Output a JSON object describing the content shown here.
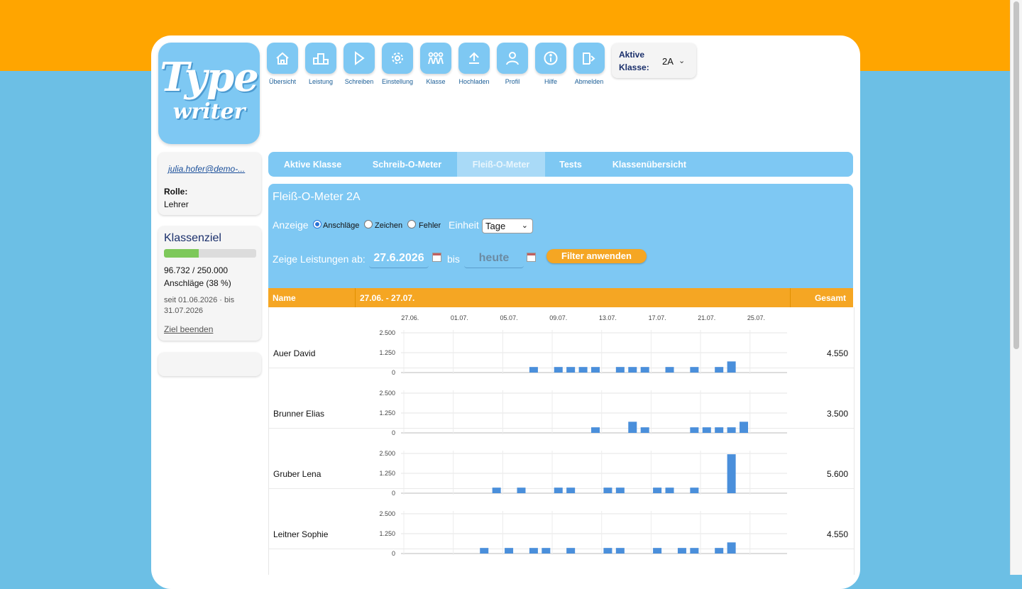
{
  "nav": [
    {
      "label": "Übersicht",
      "icon": "house-icon"
    },
    {
      "label": "Leistung",
      "icon": "podium-icon"
    },
    {
      "label": "Schreiben",
      "icon": "play-icon"
    },
    {
      "label": "Einstellung",
      "icon": "gear-icon"
    },
    {
      "label": "Klasse",
      "icon": "people-icon"
    },
    {
      "label": "Hochladen",
      "icon": "upload-icon"
    },
    {
      "label": "Profil",
      "icon": "user-icon"
    },
    {
      "label": "Hilfe",
      "icon": "info-icon"
    },
    {
      "label": "Abmelden",
      "icon": "logout-icon"
    }
  ],
  "logo": {
    "line1": "Type",
    "line2": "writer"
  },
  "class_select": {
    "label": "Aktive Klasse:",
    "value": "2A"
  },
  "user": {
    "email": "julia.hofer@demo-...",
    "role_label": "Rolle:",
    "role": "Lehrer"
  },
  "goal": {
    "title": "Klassenziel",
    "progress": 0.38,
    "numbers": "96.732 / 250.000",
    "unit": "Anschläge  (38 %)",
    "period": "seit 01.06.2026  · bis 31.07.2026",
    "end_link": "Ziel beenden"
  },
  "tabs": [
    "Aktive Klasse",
    "Schreib-O-Meter",
    "Fleiß-O-Meter",
    "Tests",
    "Klassenübersicht"
  ],
  "active_tab": 2,
  "panel": {
    "title": "Fleiß-O-Meter 2A",
    "anzeige_label": "Anzeige",
    "options": [
      "Anschläge",
      "Zeichen",
      "Fehler"
    ],
    "selected_option": 0,
    "einheit_label": "Einheit",
    "einheit_value": "Tage",
    "range_label": "Zeige Leistungen ab:",
    "from_value": "27.6.2026",
    "bis_label": "bis",
    "to_value": "heute",
    "filter_button": "Filter anwenden"
  },
  "table": {
    "col_name": "Name",
    "col_range": "27.06. - 27.07.",
    "col_total": "Gesamt"
  },
  "colors": {
    "bar": "#4a8fdb",
    "header": "#f5a623",
    "panel": "#7ec8f3",
    "band": "#ffa500",
    "background": "#6cbfe5"
  },
  "chart_data": {
    "type": "bar",
    "x_tick_labels": [
      "27.06.",
      "01.07.",
      "05.07.",
      "09.07.",
      "13.07.",
      "17.07.",
      "21.07.",
      "25.07."
    ],
    "y_tick_labels": [
      "2.500",
      "1.250",
      "0"
    ],
    "ylim": [
      0,
      2500
    ],
    "days": 31,
    "series": [
      {
        "name": "Auer David",
        "total": "4.550",
        "values": [
          0,
          0,
          0,
          0,
          0,
          0,
          0,
          0,
          0,
          0,
          350,
          0,
          350,
          350,
          350,
          350,
          0,
          350,
          350,
          350,
          0,
          350,
          0,
          350,
          0,
          350,
          700,
          0,
          0,
          0,
          0
        ]
      },
      {
        "name": "Brunner Elias",
        "total": "3.500",
        "values": [
          0,
          0,
          0,
          0,
          0,
          0,
          0,
          0,
          0,
          0,
          0,
          0,
          0,
          0,
          0,
          350,
          0,
          0,
          700,
          350,
          0,
          0,
          0,
          350,
          350,
          350,
          350,
          700,
          0,
          0,
          0
        ]
      },
      {
        "name": "Gruber Lena",
        "total": "5.600",
        "values": [
          0,
          0,
          0,
          0,
          0,
          0,
          0,
          350,
          0,
          350,
          0,
          0,
          350,
          350,
          0,
          0,
          350,
          350,
          0,
          0,
          350,
          350,
          0,
          350,
          0,
          0,
          2450,
          0,
          0,
          0,
          0
        ]
      },
      {
        "name": "Leitner Sophie",
        "total": "4.550",
        "values": [
          0,
          0,
          0,
          0,
          0,
          0,
          350,
          0,
          350,
          0,
          350,
          350,
          0,
          350,
          0,
          0,
          350,
          350,
          0,
          0,
          350,
          0,
          350,
          350,
          0,
          350,
          700,
          0,
          0,
          0,
          0
        ]
      },
      {
        "name": "",
        "total": "",
        "values": []
      }
    ]
  }
}
